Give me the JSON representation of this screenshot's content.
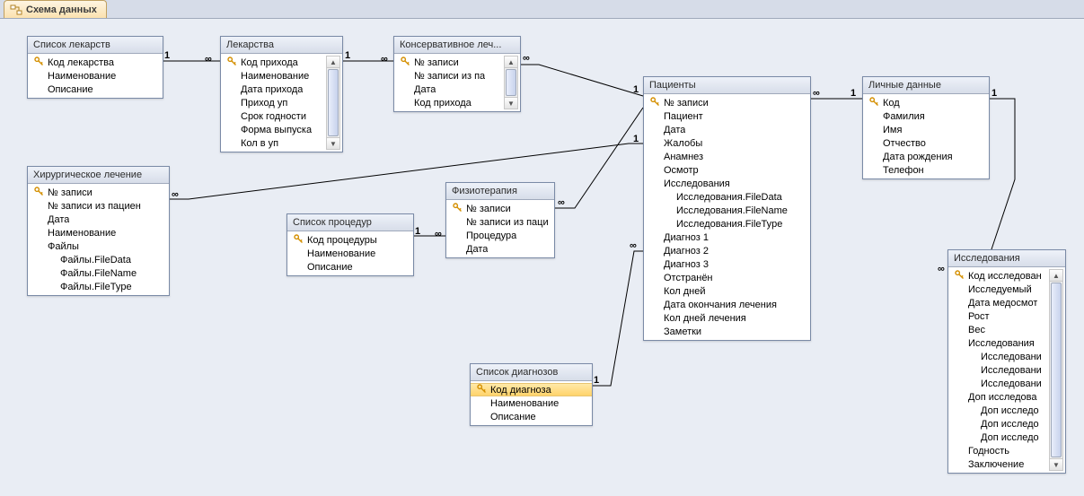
{
  "tab": {
    "title": "Схема данных"
  },
  "relationships": [
    {
      "from": "spisok_lekarstv",
      "to": "lekarstva",
      "card_from": "1",
      "card_to": "∞"
    },
    {
      "from": "lekarstva",
      "to": "konservativnoe",
      "card_from": "1",
      "card_to": "∞"
    },
    {
      "from": "patsienty",
      "to": "konservativnoe",
      "card_from": "1",
      "card_to": "∞"
    },
    {
      "from": "patsienty",
      "to": "hirurgicheskoe",
      "card_from": "1",
      "card_to": "∞"
    },
    {
      "from": "spisok_protsedur",
      "to": "fizioterapiya",
      "card_from": "1",
      "card_to": "∞"
    },
    {
      "from": "patsienty",
      "to": "fizioterapiya",
      "card_from": "1",
      "card_to": "∞"
    },
    {
      "from": "spisok_diagnozov",
      "to": "patsienty",
      "card_from": "1",
      "card_to": "∞"
    },
    {
      "from": "lichnye_dannye",
      "to": "patsienty",
      "card_from": "1",
      "card_to": "∞"
    },
    {
      "from": "lichnye_dannye",
      "to": "issledovaniya",
      "card_from": "1",
      "card_to": "∞"
    }
  ],
  "tables": {
    "spisok_lekarstv": {
      "title": "Список лекарств",
      "fields": [
        {
          "txt": "Код лекарства",
          "pk": true
        },
        {
          "txt": "Наименование"
        },
        {
          "txt": "Описание"
        }
      ]
    },
    "lekarstva": {
      "title": "Лекарства",
      "scroll": true,
      "fields": [
        {
          "txt": "Код прихода",
          "pk": true
        },
        {
          "txt": "Наименование"
        },
        {
          "txt": "Дата прихода"
        },
        {
          "txt": "Приход уп"
        },
        {
          "txt": "Срок годности"
        },
        {
          "txt": "Форма выпуска"
        },
        {
          "txt": "Кол в уп"
        }
      ]
    },
    "konservativnoe": {
      "title": "Консервативное леч...",
      "scroll": true,
      "fields": [
        {
          "txt": "№ записи",
          "pk": true
        },
        {
          "txt": "№ записи из па"
        },
        {
          "txt": "Дата"
        },
        {
          "txt": "Код прихода"
        }
      ]
    },
    "hirurgicheskoe": {
      "title": "Хирургическое лечение",
      "fields": [
        {
          "txt": "№ записи",
          "pk": true
        },
        {
          "txt": "№ записи из пациен"
        },
        {
          "txt": "Дата"
        },
        {
          "txt": "Наименование"
        },
        {
          "txt": "Файлы",
          "expand": "−"
        },
        {
          "txt": "Файлы.FileData",
          "indent": true
        },
        {
          "txt": "Файлы.FileName",
          "indent": true
        },
        {
          "txt": "Файлы.FileType",
          "indent": true
        }
      ]
    },
    "fizioterapiya": {
      "title": "Физиотерапия",
      "fields": [
        {
          "txt": "№ записи",
          "pk": true
        },
        {
          "txt": "№ записи из паци"
        },
        {
          "txt": "Процедура"
        },
        {
          "txt": "Дата"
        }
      ]
    },
    "spisok_protsedur": {
      "title": "Список процедур",
      "fields": [
        {
          "txt": "Код процедуры",
          "pk": true
        },
        {
          "txt": "Наименование"
        },
        {
          "txt": "Описание"
        }
      ]
    },
    "spisok_diagnozov": {
      "title": "Список диагнозов",
      "fields": [
        {
          "txt": "Код диагноза",
          "pk": true,
          "selected": true
        },
        {
          "txt": "Наименование"
        },
        {
          "txt": "Описание"
        }
      ]
    },
    "patsienty": {
      "title": "Пациенты",
      "fields": [
        {
          "txt": "№ записи",
          "pk": true
        },
        {
          "txt": "Пациент"
        },
        {
          "txt": "Дата"
        },
        {
          "txt": "Жалобы"
        },
        {
          "txt": "Анамнез"
        },
        {
          "txt": "Осмотр"
        },
        {
          "txt": "Исследования",
          "expand": "−"
        },
        {
          "txt": "Исследования.FileData",
          "indent": true
        },
        {
          "txt": "Исследования.FileName",
          "indent": true
        },
        {
          "txt": "Исследования.FileType",
          "indent": true
        },
        {
          "txt": "Диагноз 1"
        },
        {
          "txt": "Диагноз 2"
        },
        {
          "txt": "Диагноз 3"
        },
        {
          "txt": "Отстранён"
        },
        {
          "txt": "Кол дней"
        },
        {
          "txt": "Дата окончания лечения"
        },
        {
          "txt": "Кол дней лечения"
        },
        {
          "txt": "Заметки"
        }
      ]
    },
    "lichnye_dannye": {
      "title": "Личные данные",
      "fields": [
        {
          "txt": "Код",
          "pk": true
        },
        {
          "txt": "Фамилия"
        },
        {
          "txt": "Имя"
        },
        {
          "txt": "Отчество"
        },
        {
          "txt": "Дата рождения"
        },
        {
          "txt": "Телефон"
        }
      ]
    },
    "issledovaniya": {
      "title": "Исследования",
      "scroll": true,
      "fields": [
        {
          "txt": "Код исследован",
          "pk": true
        },
        {
          "txt": "Исследуемый"
        },
        {
          "txt": "Дата медосмот"
        },
        {
          "txt": "Рост"
        },
        {
          "txt": "Вес"
        },
        {
          "txt": "Исследования",
          "expand": "−"
        },
        {
          "txt": "Исследовани",
          "indent": true
        },
        {
          "txt": "Исследовани",
          "indent": true
        },
        {
          "txt": "Исследовани",
          "indent": true
        },
        {
          "txt": "Доп исследова",
          "expand": "−"
        },
        {
          "txt": "Доп исследо",
          "indent": true
        },
        {
          "txt": "Доп исследо",
          "indent": true
        },
        {
          "txt": "Доп исследо",
          "indent": true
        },
        {
          "txt": "Годность"
        },
        {
          "txt": "Заключение"
        }
      ]
    }
  }
}
